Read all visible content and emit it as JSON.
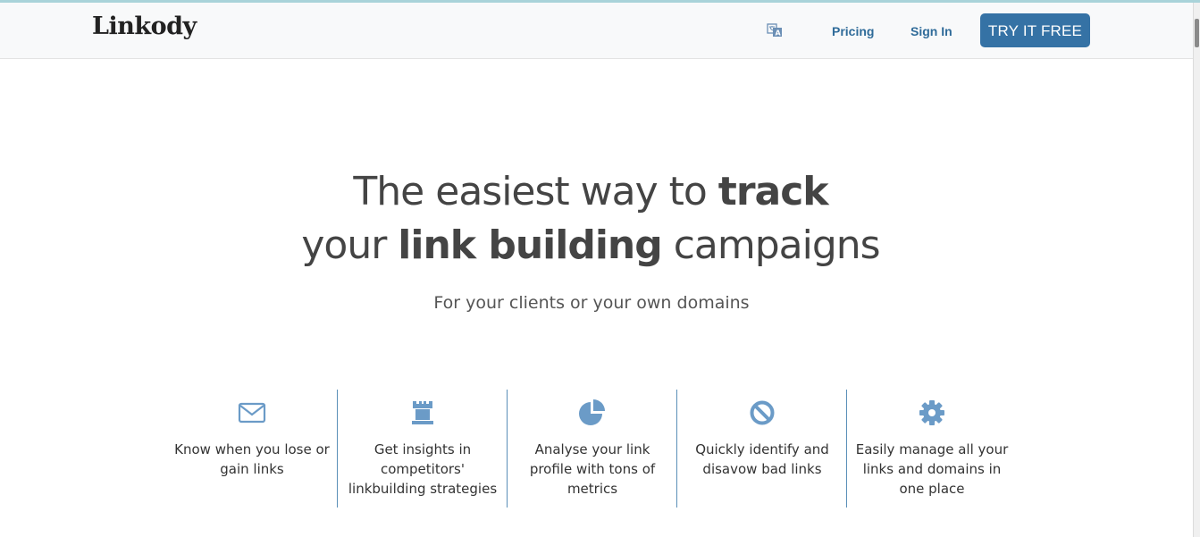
{
  "header": {
    "logo_text": "Linkody",
    "language_icon": "language-translate-icon",
    "nav": {
      "pricing_label": "Pricing",
      "signin_label": "Sign In"
    },
    "cta_label": "TRY IT FREE"
  },
  "hero": {
    "line1_normal": "The easiest way to ",
    "line1_bold": "track",
    "line2_normal_a": "your ",
    "line2_bold": "link building",
    "line2_normal_b": " campaigns",
    "subtitle": "For your clients or your own domains"
  },
  "features": [
    {
      "icon": "envelope-icon",
      "text": "Know when you lose or gain links"
    },
    {
      "icon": "rook-icon",
      "text": "Get insights in competitors' linkbuilding strategies"
    },
    {
      "icon": "pie-chart-icon",
      "text": "Analyse your link profile with tons of metrics"
    },
    {
      "icon": "ban-icon",
      "text": "Quickly identify and disavow bad links"
    },
    {
      "icon": "gear-icon",
      "text": "Easily manage all your links and domains in one place"
    }
  ],
  "colors": {
    "accent": "#3572a5",
    "nav_link": "#2f6b99",
    "icon": "#6b9bc7",
    "divider": "#5a8fb8"
  }
}
